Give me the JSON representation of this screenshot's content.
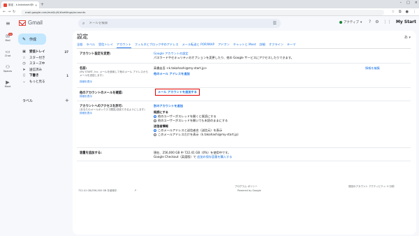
{
  "browser": {
    "tab_title": "設定 - k.takahashi@my-start.jp",
    "url": "mail.google.com/mail/u/0/#settings/accounts"
  },
  "header": {
    "brand": "Gmail",
    "search_placeholder": "メールを検索",
    "status": "アクティブ",
    "right_brand": "My Start"
  },
  "rail": {
    "mail_label": "Mail",
    "mail_badge": "99",
    "chat_label": "Chat",
    "spaces_label": "Spaces",
    "meet_label": "Meet"
  },
  "sidebar": {
    "compose": "作成",
    "items": [
      {
        "label": "受信トレイ",
        "count": "37",
        "bold": true
      },
      {
        "label": "スター付き",
        "count": ""
      },
      {
        "label": "スヌーズ中",
        "count": ""
      },
      {
        "label": "送信済み",
        "count": ""
      },
      {
        "label": "下書き",
        "count": "1",
        "bold": true
      },
      {
        "label": "もっと見る",
        "count": ""
      }
    ],
    "labels_heading": "ラベル"
  },
  "main": {
    "title": "設定",
    "tabs": [
      "全般",
      "ラベル",
      "受信トレイ",
      "アカウント",
      "フィルタとブロック中のアドレス",
      "メール転送と POP/IMAP",
      "アドオン",
      "チャットと Meet",
      "詳細",
      "オフライン",
      "テーマ"
    ],
    "active_tab": 3,
    "rows": {
      "change_settings": {
        "label": "アカウント設定を変更:",
        "link": "Google アカウントの設定",
        "desc": "パスワードやセキュリティのオプションを変更したり、他の Google サービスにアクセスしたりできます。"
      },
      "name": {
        "label": "名前:",
        "sub": "(My START, Inc. メールを使用して他のメール アドレスからメールを送信します)",
        "detail": "詳細を表示",
        "value": "高橋圭吾 <k.takahashi@my-start.jp>",
        "add_link": "他のメール アドレスを追加",
        "edit": "情報を編集"
      },
      "import": {
        "label": "他のアカウントのメールを確認:",
        "detail": "詳細を表示",
        "link": "メール アカウントを追加する"
      },
      "grant": {
        "label": "アカウントへのアクセスを許可:",
        "sub": "(あなたのメールボックスで閲覧/送信できるようにします)",
        "detail": "詳細を表示",
        "add_link": "別のアカウントを追加",
        "read_heading": "既読にする",
        "read_options": [
          "他のユーザーがスレッドを開くと既読にする",
          "他のユーザーがスレッドを開いても未読のままにする"
        ],
        "sender_heading": "送信者情報",
        "sender_options": [
          "このメールアドレスと送信者名（送信元）を表示",
          "このメールアドレスだけを表示（k.takahashi@my-start.jp）"
        ]
      },
      "storage": {
        "label": "容量を追加する:",
        "usage": "現在、256,000 GB 中 722.41 GB（0%）を使用中です。",
        "checkout_prefix": "Google Checkout（英語版）で",
        "checkout_link": "追加の保存容量を購入する"
      }
    },
    "footer": {
      "left": "722.41 GB/256,000 GB を使用中",
      "center_top": "プログラム ポリシー",
      "center_bottom": "Powered by Google",
      "right": "前回のアカウント アクティビティ: 0 分前"
    }
  }
}
